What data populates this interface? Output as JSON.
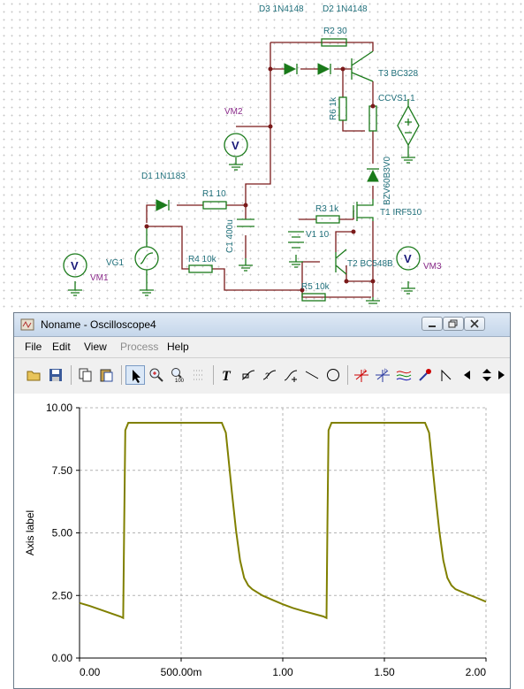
{
  "schematic": {
    "labels": {
      "d3": "D3 1N4148",
      "d2": "D2 1N4148",
      "r2": "R2 30",
      "t3": "T3 BC328",
      "r6": "R6 1k",
      "ccvs": "CCVS1 1",
      "vm2": "VM2",
      "zener": "BZV60B3V0",
      "d1": "D1 1N1183",
      "r1": "R1 10",
      "c1": "C1 400u",
      "r3": "R3 1k",
      "t1": "T1 IRF510",
      "v1": "V1 10",
      "vg1": "VG1",
      "vm1": "VM1",
      "r4": "R4 10k",
      "t2": "T2 BC548B",
      "vm3": "VM3",
      "r5": "R5 10k"
    },
    "meter_symbol": "V"
  },
  "window": {
    "title": "Noname - Oscilloscope4",
    "menu": [
      "File",
      "Edit",
      "View",
      "Process",
      "Help"
    ],
    "menu_disabled": [
      "Process"
    ]
  },
  "chart_data": {
    "type": "line",
    "title": "",
    "xlabel": "",
    "ylabel": "Axis label",
    "xlim": [
      0,
      2.0
    ],
    "ylim": [
      0,
      10.0
    ],
    "x_ticks": [
      "0.00",
      "500.00m",
      "1.00",
      "1.50",
      "2.00"
    ],
    "x_tick_values": [
      0,
      0.5,
      1.0,
      1.5,
      2.0
    ],
    "y_ticks": [
      "0.00",
      "2.50",
      "5.00",
      "7.50",
      "10.00"
    ],
    "y_tick_values": [
      0,
      2.5,
      5.0,
      7.5,
      10.0
    ],
    "grid": true,
    "series": [
      {
        "color": "#808000",
        "x": [
          0,
          0.05,
          0.1,
          0.15,
          0.2,
          0.215,
          0.22,
          0.225,
          0.24,
          0.3,
          0.4,
          0.5,
          0.6,
          0.7,
          0.72,
          0.73,
          0.75,
          0.77,
          0.79,
          0.81,
          0.83,
          0.85,
          0.9,
          0.95,
          1.0,
          1.05,
          1.1,
          1.15,
          1.2,
          1.215,
          1.22,
          1.225,
          1.24,
          1.3,
          1.4,
          1.5,
          1.6,
          1.7,
          1.72,
          1.73,
          1.75,
          1.77,
          1.79,
          1.81,
          1.83,
          1.85,
          1.9,
          1.95,
          2.0
        ],
        "y": [
          2.2,
          2.08,
          1.94,
          1.8,
          1.66,
          1.6,
          5.5,
          9.1,
          9.4,
          9.4,
          9.4,
          9.4,
          9.4,
          9.4,
          9.0,
          8.2,
          6.6,
          5.1,
          3.9,
          3.2,
          2.9,
          2.75,
          2.5,
          2.32,
          2.15,
          2.0,
          1.88,
          1.77,
          1.66,
          1.6,
          5.5,
          9.1,
          9.4,
          9.4,
          9.4,
          9.4,
          9.4,
          9.4,
          9.0,
          8.2,
          6.6,
          5.1,
          3.9,
          3.2,
          2.9,
          2.75,
          2.58,
          2.42,
          2.25
        ]
      }
    ]
  }
}
